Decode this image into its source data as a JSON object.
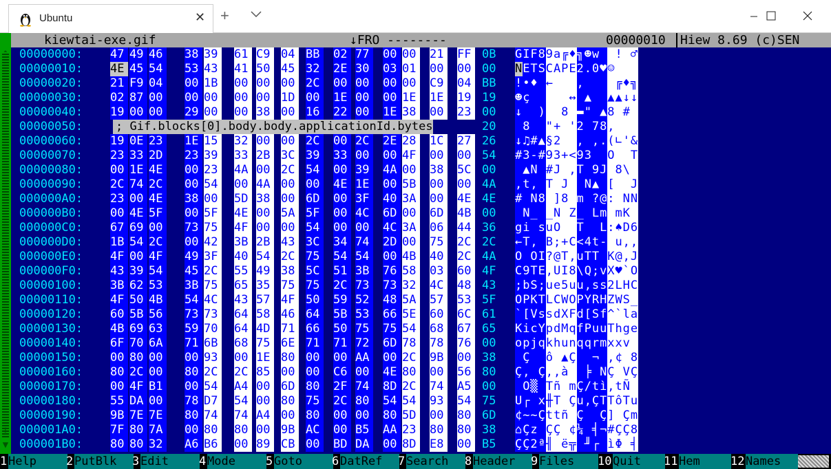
{
  "window": {
    "tab_title": "Ubuntu",
    "tab_icon": "linux-penguin-icon"
  },
  "status_bar": {
    "filename": "kiewtai-exe.gif",
    "mode": "↓FRO --------",
    "offset": "00000010",
    "app": "Hiew 8.69 (c)SEN"
  },
  "comment": "; Gif.blocks[0].body.body.applicationId.bytes",
  "rows": [
    {
      "addr": "00000000:",
      "hex": [
        "47",
        "49",
        "46",
        "38",
        "39",
        "61",
        "C9",
        "04",
        "BB",
        "02",
        "77",
        "00",
        "00",
        "21",
        "FF",
        "0B"
      ],
      "ascii": "GIF89a╔♦╗☻w  ! ♂"
    },
    {
      "addr": "00000010:",
      "hex": [
        "4E",
        "45",
        "54",
        "53",
        "43",
        "41",
        "50",
        "45",
        "32",
        "2E",
        "30",
        "03",
        "01",
        "00",
        "00",
        "00"
      ],
      "ascii": "NETSCAPE2.0♥☺   "
    },
    {
      "addr": "00000020:",
      "hex": [
        "21",
        "F9",
        "04",
        "00",
        "1B",
        "00",
        "00",
        "00",
        "2C",
        "00",
        "00",
        "00",
        "00",
        "C9",
        "04",
        "BB"
      ],
      "ascii": "!•♦ ←   ,    ╔♦╗"
    },
    {
      "addr": "00000030:",
      "hex": [
        "02",
        "87",
        "00",
        "00",
        "00",
        "00",
        "00",
        "1D",
        "00",
        "1E",
        "00",
        "00",
        "1E",
        "1E",
        "19",
        "19"
      ],
      "ascii": "☻ç     ↔ ▲  ▲▲↓↓"
    },
    {
      "addr": "00000040:",
      "hex": [
        "19",
        "00",
        "00",
        "29",
        "00",
        "00",
        "38",
        "00",
        "16",
        "22",
        "00",
        "1E",
        "38",
        "00",
        "23",
        "00"
      ],
      "ascii": "↓  )  8 ▬\" ▲8 # "
    },
    {
      "addr": "00000050:",
      "hex": [
        "",
        "",
        "",
        "",
        "",
        "",
        "",
        "",
        "",
        "",
        "",
        "",
        "",
        "",
        "",
        "20"
      ],
      "ascii": " 8  \"+ '2 78,   "
    },
    {
      "addr": "00000060:",
      "hex": [
        "19",
        "0E",
        "23",
        "1E",
        "15",
        "32",
        "00",
        "00",
        "2C",
        "00",
        "2C",
        "2E",
        "28",
        "1C",
        "27",
        "26"
      ],
      "ascii": "↓♫#▲§2  , ,.(∟'&"
    },
    {
      "addr": "00000070:",
      "hex": [
        "23",
        "33",
        "2D",
        "23",
        "39",
        "33",
        "2B",
        "3C",
        "39",
        "33",
        "00",
        "00",
        "4F",
        "00",
        "00",
        "54"
      ],
      "ascii": "#3-#93+<93  O  T"
    },
    {
      "addr": "00000080:",
      "hex": [
        "00",
        "1E",
        "4E",
        "00",
        "23",
        "4A",
        "00",
        "2C",
        "54",
        "00",
        "39",
        "4A",
        "00",
        "38",
        "5C",
        "00"
      ],
      "ascii": " ▲N #J ,T 9J 8\\ "
    },
    {
      "addr": "00000090:",
      "hex": [
        "2C",
        "74",
        "2C",
        "00",
        "54",
        "00",
        "4A",
        "00",
        "00",
        "4E",
        "1E",
        "00",
        "5B",
        "00",
        "00",
        "4A"
      ],
      "ascii": ",t, T J  N▲ [  J"
    },
    {
      "addr": "000000A0:",
      "hex": [
        "23",
        "00",
        "4E",
        "38",
        "00",
        "5D",
        "38",
        "00",
        "6D",
        "00",
        "3F",
        "40",
        "3A",
        "00",
        "4E",
        "4E"
      ],
      "ascii": "# N8 ]8 m ?@: NN"
    },
    {
      "addr": "000000B0:",
      "hex": [
        "00",
        "4E",
        "5F",
        "00",
        "5F",
        "4E",
        "00",
        "5A",
        "5F",
        "00",
        "4C",
        "6D",
        "00",
        "6D",
        "4B",
        "00"
      ],
      "ascii": " N_ _N Z_ Lm mK "
    },
    {
      "addr": "000000C0:",
      "hex": [
        "67",
        "69",
        "00",
        "73",
        "75",
        "4F",
        "00",
        "00",
        "54",
        "00",
        "00",
        "4C",
        "3A",
        "06",
        "44",
        "36"
      ],
      "ascii": "gi suO  T  L:♠D6"
    },
    {
      "addr": "000000D0:",
      "hex": [
        "1B",
        "54",
        "2C",
        "00",
        "42",
        "3B",
        "2B",
        "43",
        "3C",
        "34",
        "74",
        "2D",
        "00",
        "75",
        "2C",
        "2C"
      ],
      "ascii": "←T, B;+C<4t- u,,"
    },
    {
      "addr": "000000E0:",
      "hex": [
        "4F",
        "00",
        "4F",
        "49",
        "3F",
        "40",
        "54",
        "2C",
        "75",
        "54",
        "54",
        "00",
        "4B",
        "40",
        "2C",
        "4A"
      ],
      "ascii": "O OI?@T,uTT K@,J"
    },
    {
      "addr": "000000F0:",
      "hex": [
        "43",
        "39",
        "54",
        "45",
        "2C",
        "55",
        "49",
        "38",
        "5C",
        "51",
        "3B",
        "76",
        "58",
        "03",
        "60",
        "4F"
      ],
      "ascii": "C9TE,UI8\\Q;vX♥`O"
    },
    {
      "addr": "00000100:",
      "hex": [
        "3B",
        "62",
        "53",
        "3B",
        "75",
        "65",
        "35",
        "75",
        "75",
        "2C",
        "73",
        "73",
        "32",
        "4C",
        "48",
        "43"
      ],
      "ascii": ";bS;ue5uu,ss2LHC"
    },
    {
      "addr": "00000110:",
      "hex": [
        "4F",
        "50",
        "4B",
        "54",
        "4C",
        "43",
        "57",
        "4F",
        "50",
        "59",
        "52",
        "48",
        "5A",
        "57",
        "53",
        "5F"
      ],
      "ascii": "OPKTLCWOPYRHZWS_"
    },
    {
      "addr": "00000120:",
      "hex": [
        "60",
        "5B",
        "56",
        "73",
        "73",
        "64",
        "58",
        "46",
        "64",
        "5B",
        "53",
        "66",
        "5E",
        "60",
        "6C",
        "61"
      ],
      "ascii": "`[VssdXFd[Sf^`la"
    },
    {
      "addr": "00000130:",
      "hex": [
        "4B",
        "69",
        "63",
        "59",
        "70",
        "64",
        "4D",
        "71",
        "66",
        "50",
        "75",
        "75",
        "54",
        "68",
        "67",
        "65"
      ],
      "ascii": "KicYpdMqfPuuThge"
    },
    {
      "addr": "00000140:",
      "hex": [
        "6F",
        "70",
        "6A",
        "71",
        "6B",
        "68",
        "75",
        "6E",
        "71",
        "71",
        "72",
        "6D",
        "78",
        "78",
        "76",
        "00"
      ],
      "ascii": "opjqkhunqqrmxxv "
    },
    {
      "addr": "00000150:",
      "hex": [
        "00",
        "80",
        "00",
        "00",
        "93",
        "00",
        "1E",
        "80",
        "00",
        "00",
        "AA",
        "00",
        "2C",
        "9B",
        "00",
        "38"
      ],
      "ascii": " Ç  ô ▲Ç  ¬ ,¢ 8"
    },
    {
      "addr": "00000160:",
      "hex": [
        "80",
        "2C",
        "00",
        "80",
        "2C",
        "2C",
        "85",
        "00",
        "00",
        "C6",
        "00",
        "4E",
        "80",
        "00",
        "56",
        "80"
      ],
      "ascii": "Ç, Ç,,à  ╞ NÇ VÇ"
    },
    {
      "addr": "00000170:",
      "hex": [
        "00",
        "4F",
        "B1",
        "00",
        "54",
        "A4",
        "00",
        "6D",
        "80",
        "2F",
        "74",
        "8D",
        "2C",
        "74",
        "A5",
        "00"
      ],
      "ascii": " O▒ Tñ mÇ/tì,tÑ "
    },
    {
      "addr": "00000180:",
      "hex": [
        "55",
        "DA",
        "00",
        "78",
        "D7",
        "54",
        "00",
        "80",
        "75",
        "2C",
        "80",
        "54",
        "54",
        "93",
        "54",
        "75"
      ],
      "ascii": "U┌ x╫T Çu,ÇTTôTu"
    },
    {
      "addr": "00000190:",
      "hex": [
        "9B",
        "7E",
        "7E",
        "80",
        "74",
        "74",
        "A4",
        "00",
        "80",
        "00",
        "00",
        "80",
        "5D",
        "00",
        "80",
        "6D"
      ],
      "ascii": "¢~~Çttñ Ç  Ç] Çm"
    },
    {
      "addr": "000001A0:",
      "hex": [
        "7F",
        "80",
        "7A",
        "00",
        "80",
        "80",
        "00",
        "9B",
        "AC",
        "00",
        "B5",
        "AA",
        "23",
        "80",
        "80",
        "38"
      ],
      "ascii": "⌂Çz ÇÇ ¢¼ ╡¬#ÇÇ8"
    },
    {
      "addr": "000001B0:",
      "hex": [
        "80",
        "80",
        "32",
        "A6",
        "B6",
        "00",
        "89",
        "CB",
        "00",
        "BD",
        "DA",
        "00",
        "8D",
        "E8",
        "00",
        "B5"
      ],
      "ascii": "ÇÇ2ª╢ ë╦ ╜┌ ìΦ ╡"
    }
  ],
  "fkeys": [
    {
      "num": "1",
      "label": "Help"
    },
    {
      "num": "2",
      "label": "PutBlk"
    },
    {
      "num": "3",
      "label": "Edit"
    },
    {
      "num": "4",
      "label": "Mode"
    },
    {
      "num": "5",
      "label": "Goto"
    },
    {
      "num": "6",
      "label": "DatRef"
    },
    {
      "num": "7",
      "label": "Search"
    },
    {
      "num": "8",
      "label": "Header"
    },
    {
      "num": "9",
      "label": "Files"
    },
    {
      "num": "10",
      "label": "Quit"
    },
    {
      "num": "11",
      "label": "Hem"
    },
    {
      "num": "12",
      "label": "Names"
    }
  ],
  "colors": {
    "background": "#000080",
    "hex_blue": "#0000ff",
    "address": "#00e5ff",
    "fkey_label": "#008080",
    "status_bar": "#a8a8a8"
  }
}
